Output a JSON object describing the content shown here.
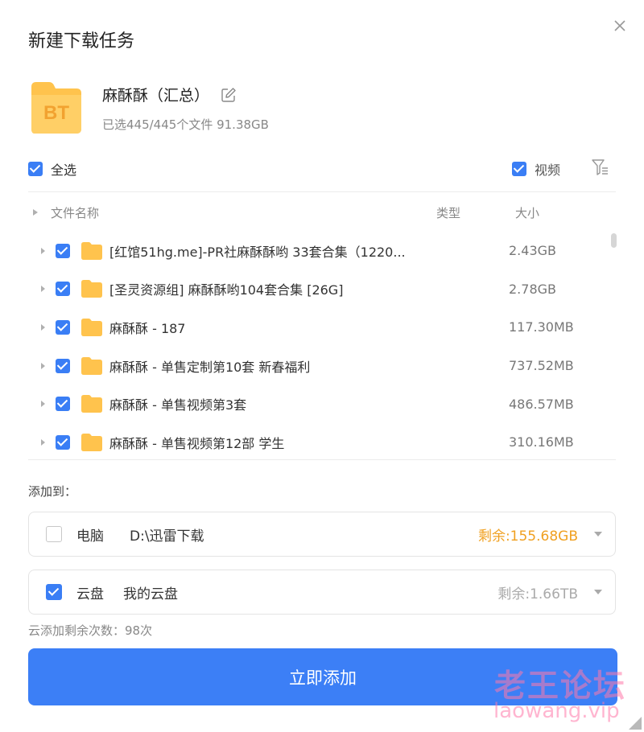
{
  "dialog": {
    "title": "新建下载任务"
  },
  "task": {
    "icon_label": "BT",
    "name": "麻酥酥（汇总）",
    "info": "已选445/445个文件 91.38GB"
  },
  "filters": {
    "select_all_label": "全选",
    "video_label": "视频"
  },
  "list": {
    "headers": {
      "name": "文件名称",
      "type": "类型",
      "size": "大小"
    },
    "rows": [
      {
        "name": "[红馆51hg.me]-PR社麻酥酥哟 33套合集（1220...",
        "size": "2.43GB",
        "checked": true
      },
      {
        "name": "[圣灵资源组] 麻酥酥哟104套合集 [26G]",
        "size": "2.78GB",
        "checked": true
      },
      {
        "name": "麻酥酥 - 187",
        "size": "117.30MB",
        "checked": true
      },
      {
        "name": "麻酥酥 - 单售定制第10套 新春福利",
        "size": "737.52MB",
        "checked": true
      },
      {
        "name": "麻酥酥 - 单售视频第3套",
        "size": "486.57MB",
        "checked": true
      },
      {
        "name": "麻酥酥 - 单售视频第12部 学生",
        "size": "310.16MB",
        "checked": true
      }
    ]
  },
  "destination": {
    "label": "添加到：",
    "local": {
      "type": "电脑",
      "path": "D:\\迅雷下载",
      "free": "剩余:155.68GB",
      "checked": false,
      "free_color": "#f0a020"
    },
    "cloud": {
      "type": "云盘",
      "path": "我的云盘",
      "free": "剩余:1.66TB",
      "checked": true,
      "free_color": "#aaaaaa"
    },
    "quota": "云添加剩余次数：98次"
  },
  "action": {
    "add_label": "立即添加"
  },
  "watermark": {
    "line1": "老王论坛",
    "line2": "laowang.vip"
  },
  "colors": {
    "accent": "#3c7ff6",
    "folder": "#ffc34d"
  }
}
